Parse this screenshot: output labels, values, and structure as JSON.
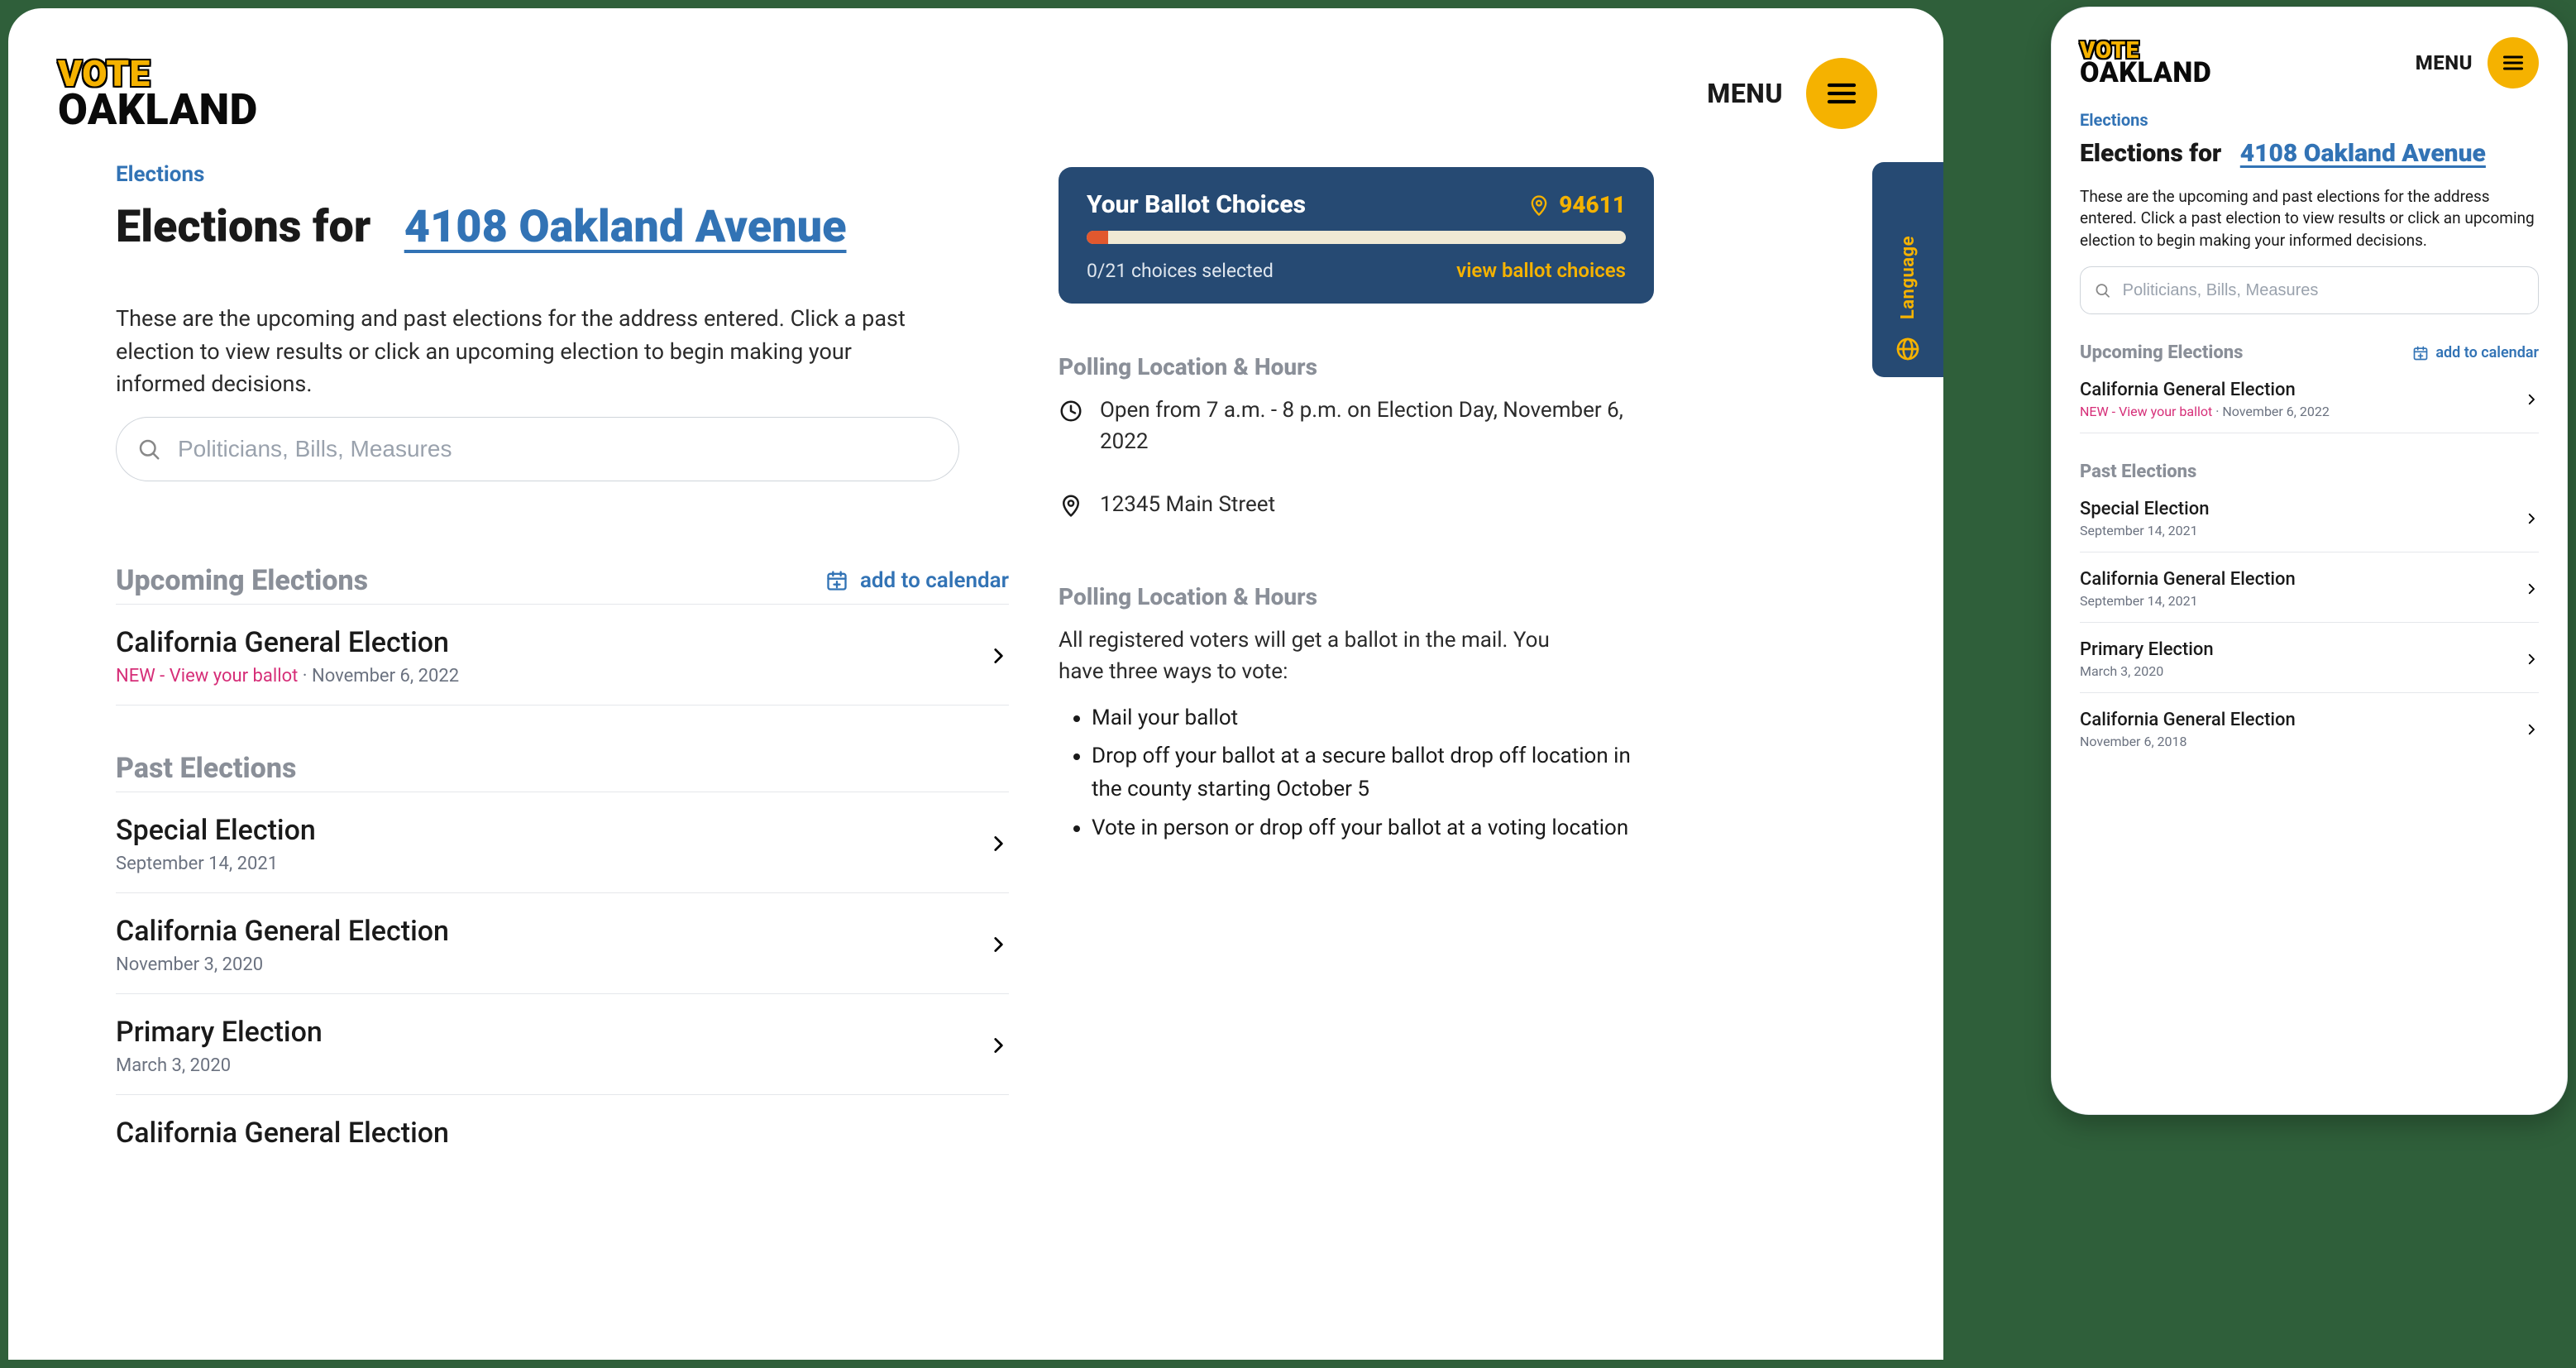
{
  "brand": {
    "line1": "VOTE",
    "line2": "OAKLAND"
  },
  "header": {
    "menu_label": "MENU"
  },
  "crumb": "Elections",
  "title_prefix": "Elections for",
  "address": "4108 Oakland Avenue",
  "intro": "These are the upcoming and past elections for the address entered. Click a past election to view results or click an upcoming election to begin making your informed decisions.",
  "search": {
    "placeholder": "Politicians, Bills, Measures"
  },
  "add_calendar_label": "add to calendar",
  "upcoming": {
    "heading": "Upcoming Elections",
    "items": [
      {
        "name": "California General Election",
        "new_label": "NEW - View your ballot",
        "date": "November 6, 2022"
      }
    ]
  },
  "past": {
    "heading": "Past Elections",
    "items": [
      {
        "name": "Special Election",
        "date": "September 14, 2021"
      },
      {
        "name": "California General Election",
        "date": "November 3, 2020"
      },
      {
        "name": "Primary Election",
        "date": "March 3, 2020"
      },
      {
        "name": "California General Election",
        "date": ""
      }
    ]
  },
  "ballot": {
    "title": "Your Ballot Choices",
    "zip": "94611",
    "count_text": "0/21 choices selected",
    "link_text": "view ballot choices"
  },
  "language_tab": "Language",
  "poll_a": {
    "heading": "Polling Location & Hours",
    "open_text": "Open from 7 a.m. - 8 p.m. on Election Day, November 6, 2022",
    "address": "12345 Main Street"
  },
  "poll_b": {
    "heading": "Polling Location & Hours",
    "text": "All registered voters will get a ballot in the mail. You have three ways to vote:",
    "bullets": [
      "Mail your ballot",
      "Drop off your ballot at a secure ballot drop off location in the county starting October 5",
      "Vote in person or drop off your ballot at a voting location"
    ]
  },
  "mobile": {
    "past": {
      "items": [
        {
          "name": "Special Election",
          "date": "September 14, 2021"
        },
        {
          "name": "California General Election",
          "date": "September 14, 2021"
        },
        {
          "name": "Primary Election",
          "date": "March 3, 2020"
        },
        {
          "name": "California General Election",
          "date": "November 6, 2018"
        }
      ]
    }
  }
}
